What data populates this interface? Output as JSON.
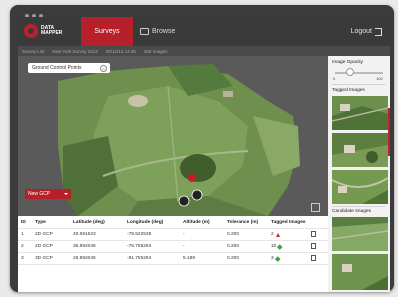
{
  "app": {
    "brand": "DATA MAPPER"
  },
  "nav": {
    "surveys": "Surveys",
    "browse": "Browse",
    "logout": "Logout"
  },
  "breadcrumbs": [
    "Survey List",
    "New York Survey 2013",
    "05/12/13 14:35",
    "300 Images"
  ],
  "map": {
    "search_placeholder": "Ground Control Points"
  },
  "actions": {
    "new_gcp": "New GCP"
  },
  "table": {
    "headers": [
      "ID",
      "Type",
      "Latitude (deg)",
      "Longitude (deg)",
      "Altitude (m)",
      "Tolerance (m)",
      "Tagged Images"
    ],
    "rows": [
      {
        "id": "1",
        "type": "2D GCP",
        "lat": "40.691523",
        "lon": "-79.522538",
        "alt": "-",
        "tol": "0.200",
        "tagged": "2",
        "status": "warning"
      },
      {
        "id": "2",
        "type": "2D GCP",
        "lat": "35.892046",
        "lon": "-78.755294",
        "alt": "-",
        "tol": "0.200",
        "tagged": "10",
        "status": "ok"
      },
      {
        "id": "3",
        "type": "3D GCP",
        "lat": "26.892046",
        "lon": "-81.755294",
        "alt": "5.189",
        "tol": "0.200",
        "tagged": "3",
        "status": "ok"
      }
    ]
  },
  "sidebar": {
    "opacity_label": "Image Opacity",
    "opacity_min": "0",
    "opacity_max": "100",
    "opacity_value": 0.3,
    "tagged_label": "Tagged Images",
    "candidate_label": "Candidate Images"
  },
  "colors": {
    "accent": "#b5202a",
    "topbar": "#3a3a3a",
    "warning": "#d12a2a",
    "ok": "#3aa44a"
  }
}
